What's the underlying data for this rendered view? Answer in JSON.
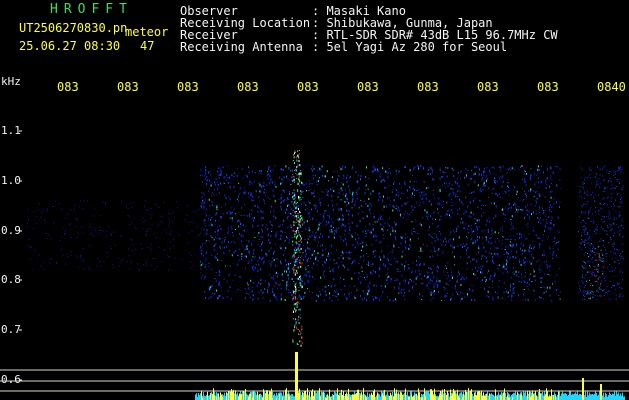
{
  "header": {
    "brand": "HROFFT",
    "filename": "UT2506270830.pn",
    "mode": "meteor",
    "datetime": "25.06.27 08:30",
    "count": "47"
  },
  "info": {
    "rows": [
      {
        "label": "Observer",
        "value": ": Masaki Kano"
      },
      {
        "label": "Receiving Location",
        "value": ": Shibukawa, Gunma, Japan"
      },
      {
        "label": "Receiver",
        "value": ": RTL-SDR SDR# 43dB L15 96.7MHz CW"
      },
      {
        "label": "Receiving Antenna",
        "value": ": 5el Yagi Az 280 for Seoul"
      }
    ]
  },
  "spectrogram": {
    "y_unit": "kHz",
    "x_ticks": [
      "083",
      "083",
      "083",
      "083",
      "083",
      "083",
      "083",
      "083",
      "083",
      "0840"
    ],
    "y_ticks": [
      "1.1",
      "1.0",
      "0.9",
      "0.8",
      "0.7",
      "0.6"
    ],
    "colors": {
      "background": "#000000",
      "text_yellow": "#ffff3a",
      "text_green": "#3fdc5a",
      "signal_blue": "#1a3cff",
      "signal_cyan": "#22d6ff",
      "meteor_red": "#ff2a2a"
    }
  }
}
